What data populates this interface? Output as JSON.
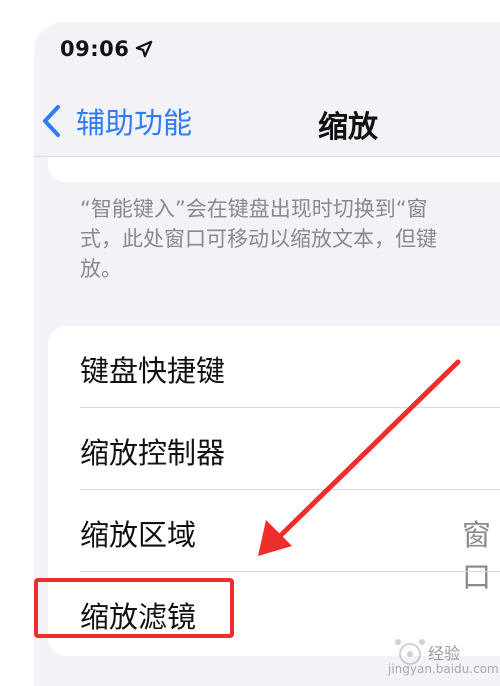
{
  "status_bar": {
    "time": "09:06"
  },
  "nav": {
    "back_label": "辅助功能",
    "title": "缩放"
  },
  "footer_text": "“智能键入”会在键盘出现时切换到“窗\n式，此处窗口可移动以缩放文本，但键\n放。",
  "settings": [
    {
      "label": "键盘快捷键"
    },
    {
      "label": "缩放控制器"
    },
    {
      "label": "缩放区域",
      "value": "窗口"
    },
    {
      "label": "缩放滤镜"
    }
  ],
  "watermark": {
    "text": "经验",
    "sub": "jingyan.baidu.com"
  },
  "colors": {
    "accent": "#2f7cf6",
    "highlight": "#ee2d2d",
    "background": "#f2f2f7"
  },
  "icons": {
    "status": "location-arrow-icon",
    "back": "chevron-left-icon"
  }
}
